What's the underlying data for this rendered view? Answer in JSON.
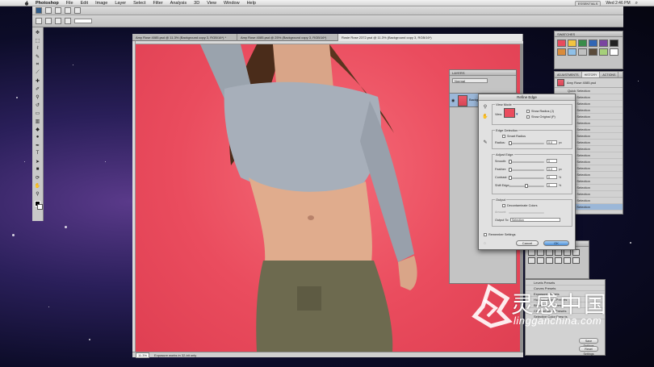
{
  "menubar": {
    "app": "Photoshop",
    "items": [
      "File",
      "Edit",
      "Image",
      "Layer",
      "Select",
      "Filter",
      "Analysis",
      "3D",
      "View",
      "Window",
      "Help"
    ],
    "workspace": "ESSENTIALS",
    "clock": "Wed 2:46 PM"
  },
  "tabs": [
    "Amy Rose 4085.psd @ 11.3% (Background copy 3, RGB/16*) *",
    "Amy Rose 4085.psd @ 25% (Background copy 3, RGB/16*)",
    "Rosie Rose 2372.psd @ 11.3% (Background copy 3, RGB/16*)"
  ],
  "statusbar": {
    "zoom": "11.3%",
    "info": "Exposure works in 32-bit only"
  },
  "layers": {
    "title": "LAYERS",
    "blend": "Normal",
    "layer_name": "Background"
  },
  "swatches": {
    "title": "SWATCHES"
  },
  "history": {
    "tabs": [
      "ADJUSTMENTS",
      "HISTORY",
      "ACTIONS"
    ],
    "snapshot": "Amy Rose 4085.psd",
    "items": [
      "Quick Selection",
      "Quick Selection",
      "Quick Selection",
      "Quick Selection",
      "Quick Selection",
      "Quick Selection",
      "Quick Selection",
      "Quick Selection",
      "Quick Selection",
      "Quick Selection",
      "Quick Selection",
      "Quick Selection",
      "Quick Selection",
      "Quick Selection",
      "Quick Selection",
      "Quick Selection",
      "Quick Selection",
      "Quick Selection",
      "Quick Selection"
    ]
  },
  "adjustments": {
    "title": "ADJUSTMENTS"
  },
  "presets": {
    "items": [
      "Levels Presets",
      "Curves Presets",
      "Exposure Presets",
      "Hue/Saturation Presets",
      "Black & White Presets",
      "Channel Mixer Presets",
      "Selective Color Presets"
    ],
    "buttons": [
      "Save Settings",
      "Reset Settings"
    ]
  },
  "refine_edge": {
    "title": "Refine Edge",
    "view_mode": "View Mode",
    "view_label": "View:",
    "show_radius": "Show Radius (J)",
    "show_original": "Show Original (P)",
    "edge_detection": "Edge Detection",
    "smart_radius": "Smart Radius",
    "radius_label": "Radius:",
    "radius_value": "0.0",
    "px": "px",
    "adjust_edge": "Adjust Edge",
    "smooth_label": "Smooth:",
    "smooth_value": "0",
    "feather_label": "Feather:",
    "feather_value": "0.0",
    "contrast_label": "Contrast:",
    "contrast_value": "0",
    "shift_label": "Shift Edge:",
    "shift_value": "0",
    "pct": "%",
    "output": "Output",
    "decontaminate": "Decontaminate Colors",
    "amount_label": "Amount:",
    "output_to_label": "Output To:",
    "output_to_value": "Selection",
    "remember": "Remember Settings",
    "cancel": "Cancel",
    "ok": "OK"
  },
  "watermark": {
    "cn": "灵感中国",
    "en": "lingganchina.com"
  }
}
